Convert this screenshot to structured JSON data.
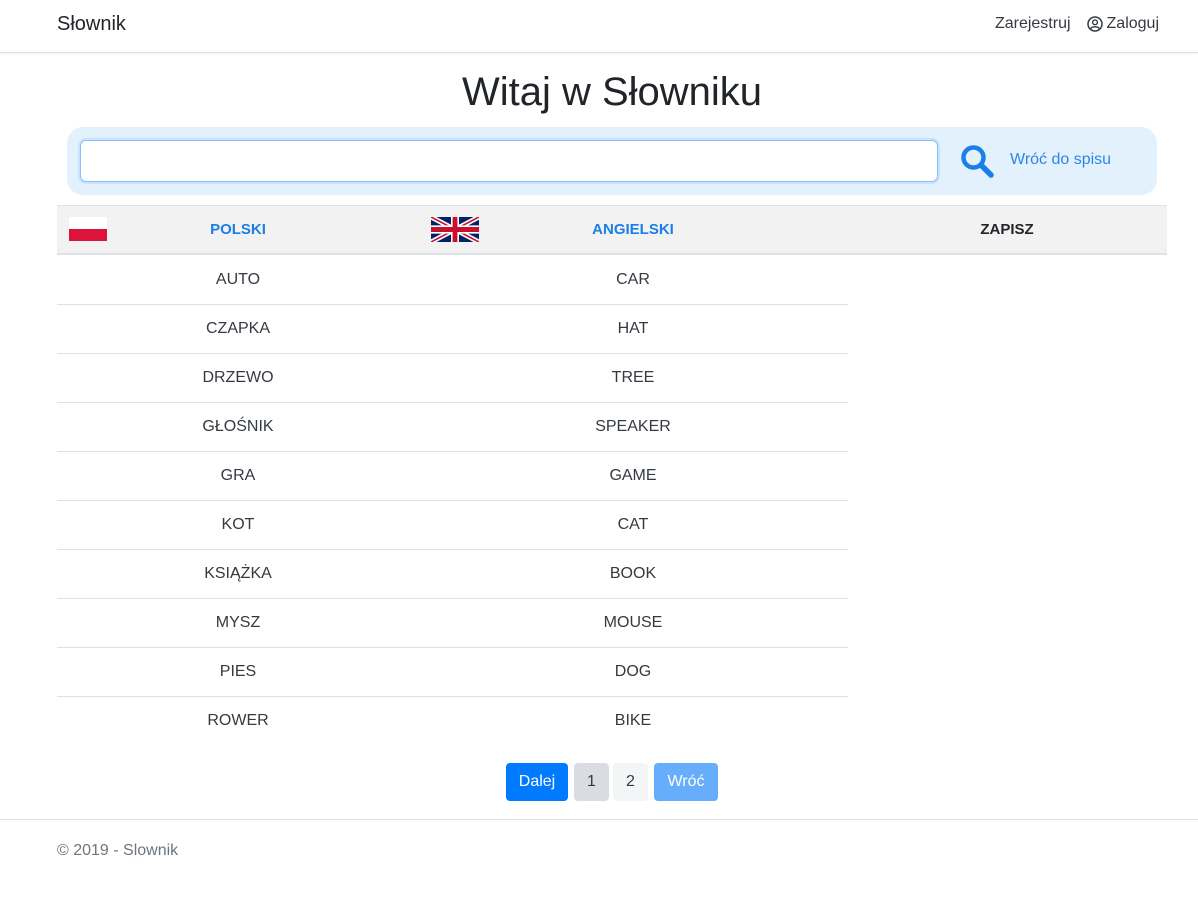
{
  "navbar": {
    "brand": "Słownik",
    "register": "Zarejestruj",
    "login": "Zaloguj"
  },
  "page_title": "Witaj w Słowniku",
  "search": {
    "value": "",
    "placeholder": "",
    "back_link": "Wróć do spisu"
  },
  "table": {
    "headers": {
      "polish": "POLSKI",
      "english": "ANGIELSKI",
      "save": "ZAPISZ"
    },
    "rows": [
      {
        "pl": "AUTO",
        "en": "CAR"
      },
      {
        "pl": "CZAPKA",
        "en": "HAT"
      },
      {
        "pl": "DRZEWO",
        "en": "TREE"
      },
      {
        "pl": "GŁOŚNIK",
        "en": "SPEAKER"
      },
      {
        "pl": "GRA",
        "en": "GAME"
      },
      {
        "pl": "KOT",
        "en": "CAT"
      },
      {
        "pl": "KSIĄŻKA",
        "en": "BOOK"
      },
      {
        "pl": "MYSZ",
        "en": "MOUSE"
      },
      {
        "pl": "PIES",
        "en": "DOG"
      },
      {
        "pl": "ROWER",
        "en": "BIKE"
      }
    ]
  },
  "pagination": {
    "next": "Dalej",
    "pages": [
      "1",
      "2"
    ],
    "back": "Wróć"
  },
  "footer": {
    "text": "© 2019 - Slownik"
  },
  "icons": {
    "user": "user-circle-icon",
    "search": "search-icon",
    "flag_pl": "poland-flag-icon",
    "flag_uk": "uk-flag-icon"
  },
  "colors": {
    "primary": "#007bff",
    "link": "#1a7fe8",
    "panel": "#e3f1fd",
    "header_bg": "#f2f2f2"
  }
}
